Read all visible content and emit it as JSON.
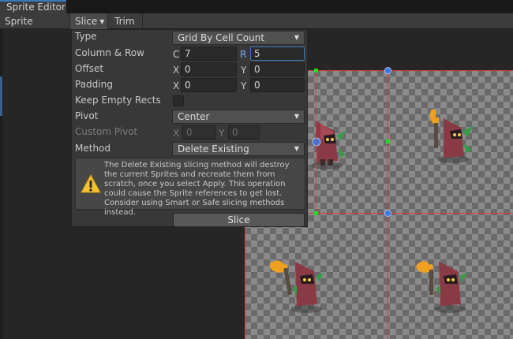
{
  "window": {
    "title": "Sprite Editor"
  },
  "toolbar": {
    "editor_menu": "Sprite Editor",
    "slice_menu": "Slice",
    "trim_button": "Trim"
  },
  "slice_panel": {
    "type_label": "Type",
    "type_value": "Grid By Cell Count",
    "column_row_label": "Column & Row",
    "column_axis": "C",
    "column_value": "7",
    "row_axis": "R",
    "row_value": "5",
    "offset_label": "Offset",
    "offset_x_axis": "X",
    "offset_x": "0",
    "offset_y_axis": "Y",
    "offset_y": "0",
    "padding_label": "Padding",
    "padding_x_axis": "X",
    "padding_x": "0",
    "padding_y_axis": "Y",
    "padding_y": "0",
    "keep_empty_label": "Keep Empty Rects",
    "keep_empty_checked": false,
    "pivot_label": "Pivot",
    "pivot_value": "Center",
    "custom_pivot_label": "Custom Pivot",
    "custom_pivot_x_axis": "X",
    "custom_pivot_x": "0",
    "custom_pivot_y_axis": "Y",
    "custom_pivot_y": "0",
    "method_label": "Method",
    "method_value": "Delete Existing",
    "help_text": "The Delete Existing slicing method will destroy the current Sprites and recreate them from scratch, once you select Apply. This operation could cause the Sprite references to get lost. Consider using Smart or Safe slicing methods instead.",
    "slice_button": "Slice"
  },
  "colors": {
    "panel_bg": "#383838",
    "grid_line": "#d43a3a",
    "handle_green": "#22dd22",
    "handle_blue": "#3d78e0",
    "focus": "#3a79bb"
  }
}
